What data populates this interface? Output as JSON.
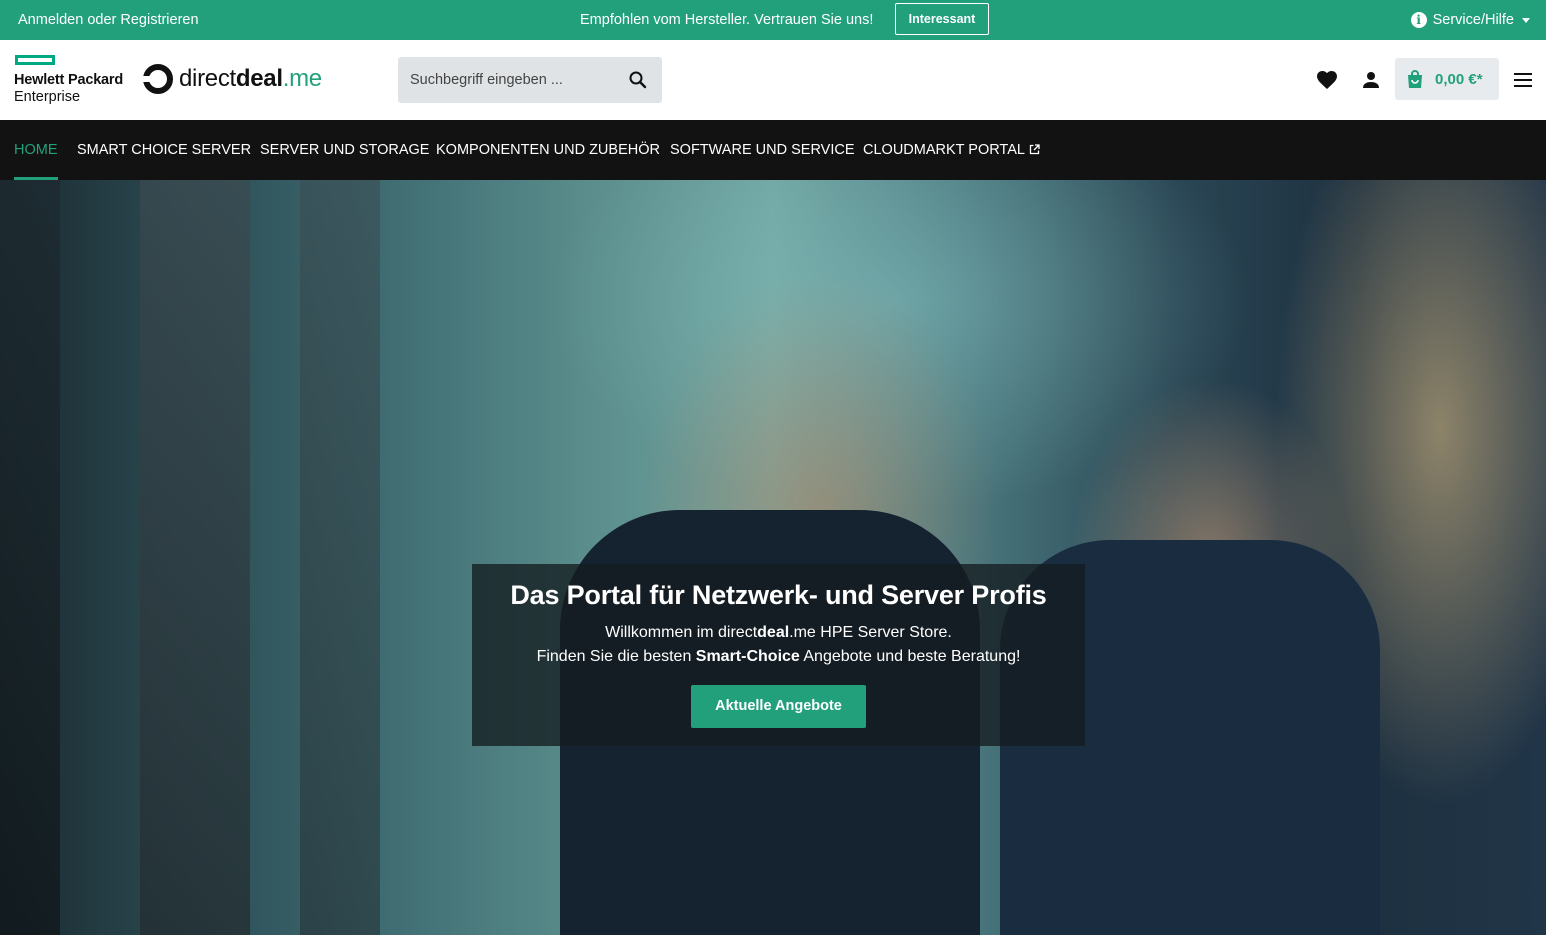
{
  "topbar": {
    "login_label": "Anmelden oder Registrieren",
    "promo_text": "Empfohlen vom Hersteller. Vertrauen Sie uns!",
    "promo_button": "Interessant",
    "service_label": "Service/Hilfe",
    "service_icon": "info-icon",
    "background_color": "#22a07c"
  },
  "header": {
    "hpe_logo": {
      "line1": "Hewlett Packard",
      "line2": "Enterprise",
      "accent_color": "#01a982"
    },
    "dd_logo": {
      "part1": "direct",
      "part2": "deal",
      "part3": ".me"
    },
    "search": {
      "placeholder": "Suchbegriff eingeben ..."
    },
    "icons": [
      "heart-icon",
      "user-icon",
      "bag-icon",
      "menu-icon"
    ],
    "cart_total": "0,00 €*"
  },
  "nav": {
    "items": [
      {
        "label": "HOME",
        "active": true
      },
      {
        "label": "SMART CHOICE SERVER",
        "active": false
      },
      {
        "label": "SERVER UND STORAGE",
        "active": false
      },
      {
        "label": "KOMPONENTEN UND ZUBEHÖR",
        "active": false
      },
      {
        "label": "SOFTWARE UND SERVICE",
        "active": false
      },
      {
        "label": "CLOUDMARKT PORTAL",
        "active": false,
        "external": true
      }
    ]
  },
  "hero": {
    "title": "Das Portal für Netzwerk- und Server Profis",
    "line1_a": "Willkommen im direct",
    "line1_b": "deal",
    "line1_c": ".me HPE Server Store.",
    "line2_a": "Finden Sie die besten ",
    "line2_b": "Smart-Choice",
    "line2_c": " Angebote und beste Beratung!",
    "cta": "Aktuelle Angebote"
  },
  "colors": {
    "accent": "#22a07c",
    "nav_bg": "#121212"
  }
}
